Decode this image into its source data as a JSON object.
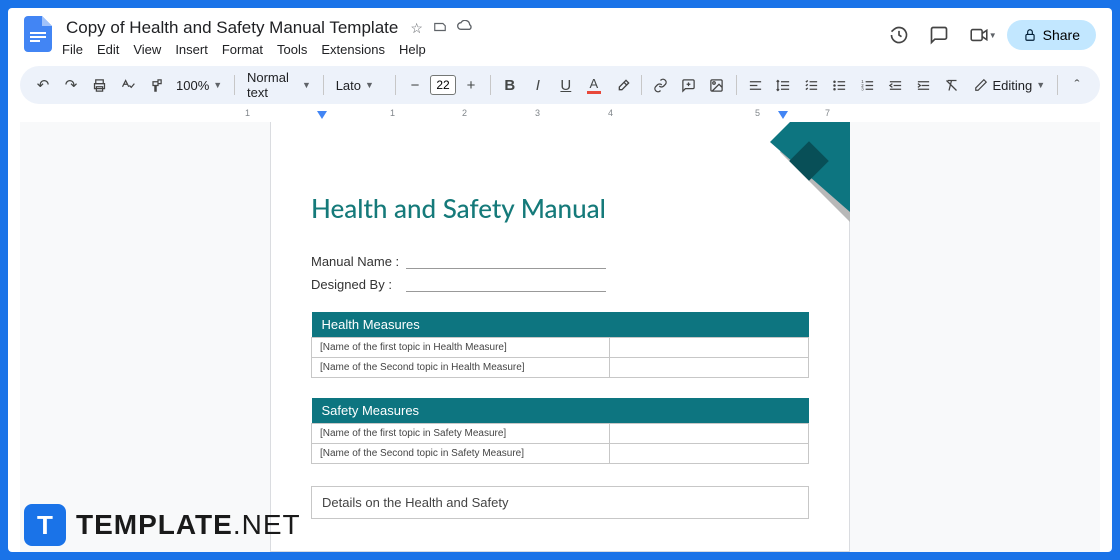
{
  "header": {
    "title": "Copy of Health and Safety Manual Template",
    "share_label": "Share"
  },
  "menus": [
    "File",
    "Edit",
    "View",
    "Insert",
    "Format",
    "Tools",
    "Extensions",
    "Help"
  ],
  "toolbar": {
    "zoom": "100%",
    "style": "Normal text",
    "font": "Lato",
    "font_size": "22",
    "editing_mode": "Editing"
  },
  "ruler": {
    "marks": [
      "1",
      "1",
      "2",
      "3",
      "4",
      "5",
      "7"
    ]
  },
  "document": {
    "title": "Health and Safety Manual",
    "fields": [
      {
        "label": "Manual Name :"
      },
      {
        "label": "Designed By :"
      }
    ],
    "sections": [
      {
        "header": "Health Measures",
        "rows": [
          "[Name of the first topic in Health Measure]",
          "[Name of the Second topic in Health Measure]"
        ]
      },
      {
        "header": "Safety Measures",
        "rows": [
          "[Name of the first topic in Safety Measure]",
          "[Name of the Second topic in Safety Measure]"
        ]
      }
    ],
    "details_label": "Details on the Health and Safety"
  },
  "brand": {
    "logo_letter": "T",
    "name_bold": "TEMPLATE",
    "name_light": ".NET"
  }
}
